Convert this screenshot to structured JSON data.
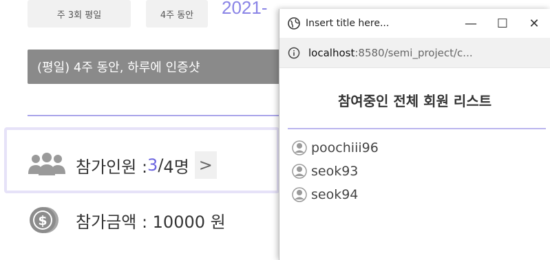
{
  "background": {
    "chips": [
      "주 3회 평일",
      "4주 동안"
    ],
    "date_fragment": "2021-",
    "notice": "(평일) 4주 동안, 하루에 인증샷",
    "members": {
      "label": "참가인원 : ",
      "current": "3",
      "separator": " / ",
      "max": "4명",
      "chevron": ">"
    },
    "fee": {
      "label": "참가금액 : 10000 원"
    }
  },
  "popup": {
    "window_title": "Insert title here...",
    "controls": {
      "minimize": "—",
      "maximize": "☐",
      "close": "✕"
    },
    "url": {
      "host": "localhost",
      "path": ":8580/semi_project/c..."
    },
    "list_title": "참여중인 전체 회원 리스트",
    "members": [
      {
        "name": "poochiii96"
      },
      {
        "name": "seok93"
      },
      {
        "name": "seok94"
      }
    ]
  },
  "colors": {
    "accent": "#6d66e0",
    "divider": "#a9a4ea",
    "icon_gray": "#9a9a9a"
  }
}
